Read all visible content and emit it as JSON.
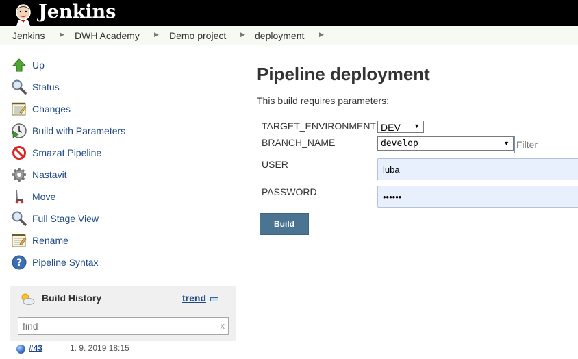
{
  "header": {
    "logo_text": "Jenkins"
  },
  "breadcrumb": [
    "Jenkins",
    "DWH Academy",
    "Demo project",
    "deployment"
  ],
  "sidebar": {
    "items": [
      {
        "label": "Up",
        "icon": "up-arrow-icon"
      },
      {
        "label": "Status",
        "icon": "magnifier-icon"
      },
      {
        "label": "Changes",
        "icon": "notepad-icon"
      },
      {
        "label": "Build with Parameters",
        "icon": "clock-play-icon"
      },
      {
        "label": "Smazat Pipeline",
        "icon": "no-entry-icon"
      },
      {
        "label": "Nastavit",
        "icon": "gear-icon"
      },
      {
        "label": "Move",
        "icon": "move-icon"
      },
      {
        "label": "Full Stage View",
        "icon": "magnifier-icon"
      },
      {
        "label": "Rename",
        "icon": "notepad-icon"
      },
      {
        "label": "Pipeline Syntax",
        "icon": "help-icon"
      }
    ]
  },
  "build_history": {
    "title": "Build History",
    "trend_label": "trend",
    "filter_placeholder": "find",
    "clear_label": "x",
    "builds": [
      {
        "number": "#43",
        "date": "1. 9. 2019 18:15",
        "status_color": "#4a7ed6"
      }
    ]
  },
  "main": {
    "title": "Pipeline deployment",
    "description": "This build requires parameters:",
    "params": {
      "target_env": {
        "label": "TARGET_ENVIRONMENT",
        "value": "DEV"
      },
      "branch": {
        "label": "BRANCH_NAME",
        "value": "develop",
        "filter_placeholder": "Filter"
      },
      "user": {
        "label": "USER",
        "value": "luba"
      },
      "password": {
        "label": "PASSWORD",
        "value": "••••••"
      }
    },
    "build_button": "Build"
  },
  "colors": {
    "header_bg": "#000000",
    "link": "#204a87",
    "button_bg": "#4a7491",
    "autofill_bg": "#e8f0fe"
  }
}
